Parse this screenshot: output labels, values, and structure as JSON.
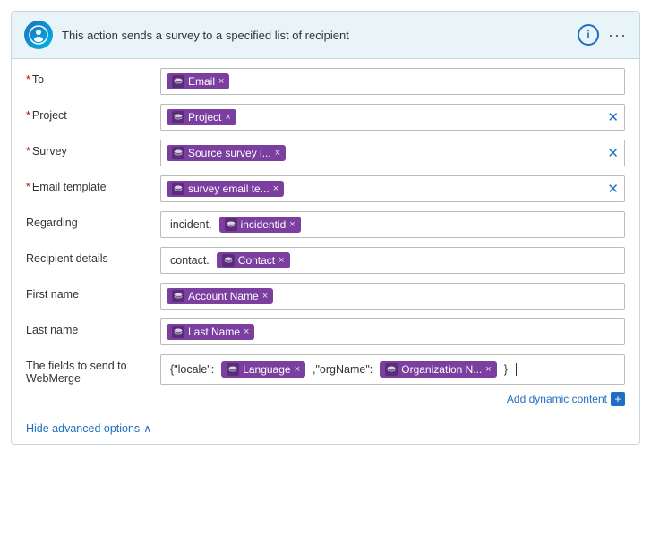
{
  "card": {
    "logo_char": "●",
    "header_title": "This action sends a survey to a specified list of recipient",
    "info_label": "i",
    "dots_label": "···"
  },
  "form": {
    "fields": [
      {
        "id": "to",
        "label": "To",
        "required": true,
        "chips": [
          {
            "text": "Email",
            "icon": "db"
          }
        ],
        "plain_prefix": "",
        "has_clear": false,
        "multiline": false
      },
      {
        "id": "project",
        "label": "Project",
        "required": true,
        "chips": [
          {
            "text": "Project",
            "icon": "db"
          }
        ],
        "plain_prefix": "",
        "has_clear": true,
        "multiline": false
      },
      {
        "id": "survey",
        "label": "Survey",
        "required": true,
        "chips": [
          {
            "text": "Source survey i...",
            "icon": "db"
          }
        ],
        "plain_prefix": "",
        "has_clear": true,
        "multiline": false
      },
      {
        "id": "email_template",
        "label": "Email template",
        "required": true,
        "chips": [
          {
            "text": "survey email te...",
            "icon": "db"
          }
        ],
        "plain_prefix": "",
        "has_clear": true,
        "multiline": false
      },
      {
        "id": "regarding",
        "label": "Regarding",
        "required": false,
        "chips": [
          {
            "text": "incidentid",
            "icon": "db"
          }
        ],
        "plain_prefix": "incident.",
        "has_clear": false,
        "multiline": false
      },
      {
        "id": "recipient_details",
        "label": "Recipient details",
        "required": false,
        "chips": [
          {
            "text": "Contact",
            "icon": "db"
          }
        ],
        "plain_prefix": "contact.",
        "has_clear": false,
        "multiline": false
      },
      {
        "id": "first_name",
        "label": "First name",
        "required": false,
        "chips": [
          {
            "text": "Account Name",
            "icon": "db"
          }
        ],
        "plain_prefix": "",
        "has_clear": false,
        "multiline": false
      },
      {
        "id": "last_name",
        "label": "Last name",
        "required": false,
        "chips": [
          {
            "text": "Last Name",
            "icon": "db"
          }
        ],
        "plain_prefix": "",
        "has_clear": false,
        "multiline": false
      },
      {
        "id": "webmerge",
        "label": "The fields to send to WebMerge",
        "required": false,
        "chips": [
          {
            "text": "Language",
            "icon": "db"
          },
          {
            "text": "Organization N...",
            "icon": "db"
          }
        ],
        "plain_prefix": "{\"locale\":",
        "plain_middle": ",\"orgName\":",
        "plain_suffix": "}",
        "has_clear": false,
        "multiline": true,
        "cursor": true
      }
    ]
  },
  "dynamic_content": {
    "link_text": "Add dynamic content",
    "plus": "+"
  },
  "hide_advanced": {
    "label": "Hide advanced options",
    "chevron": "∧"
  }
}
